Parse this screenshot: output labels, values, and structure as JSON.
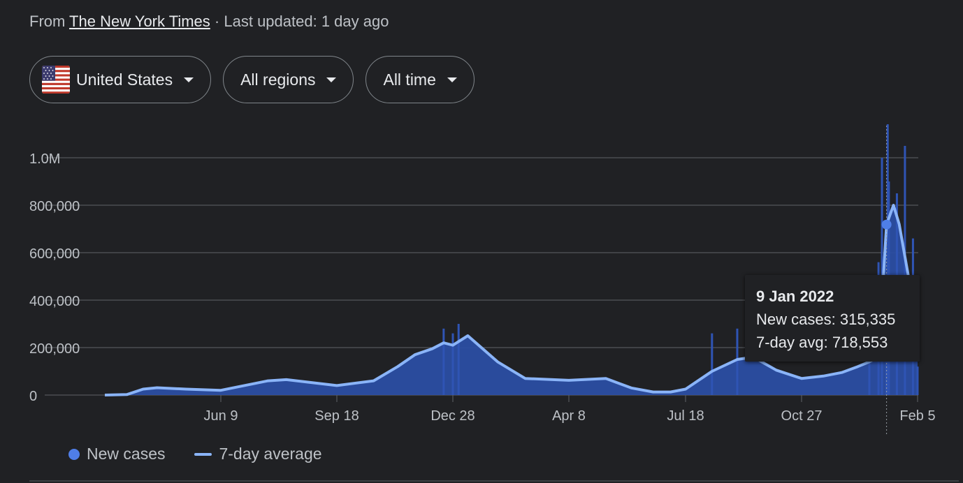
{
  "source": {
    "prefix": "From",
    "publisher": "The New York Times",
    "separator": "·",
    "updated": "Last updated: 1 day ago"
  },
  "filters": [
    {
      "label": "United States",
      "icon": "us-flag-icon"
    },
    {
      "label": "All regions",
      "icon": "caret-down-icon"
    },
    {
      "label": "All time",
      "icon": "caret-down-icon"
    }
  ],
  "colors": {
    "area": "#2b4ea3",
    "bars": "#2f54b4",
    "avg_line": "#8ab4f8",
    "grid": "#5f6368",
    "axis_text": "#bdc1c6",
    "highlight_dot": "#4f7ee8"
  },
  "legend": {
    "new_cases": "New cases",
    "avg": "7-day average"
  },
  "tooltip": {
    "date": "9 Jan 2022",
    "new_cases_label": "New cases:",
    "new_cases_value": "315,335",
    "avg_label": "7-day avg:",
    "avg_value": "718,553"
  },
  "chart_data": {
    "type": "area",
    "y_ticks": [
      {
        "value": 0,
        "label": "0"
      },
      {
        "value": 200000,
        "label": "200,000"
      },
      {
        "value": 400000,
        "label": "400,000"
      },
      {
        "value": 600000,
        "label": "600,000"
      },
      {
        "value": 800000,
        "label": "800,000"
      },
      {
        "value": 1000000,
        "label": "1.0M"
      }
    ],
    "ylim": [
      0,
      1000000
    ],
    "x_ticks": [
      "Jun 9",
      "Sep 18",
      "Dec 28",
      "Apr 8",
      "Jul 18",
      "Oct 27",
      "Feb 5"
    ],
    "grid": true,
    "legend_position": "bottom-left",
    "series": [
      {
        "name": "7-day average",
        "x": [
          "Mar 1 2020",
          "Mar 20 2020",
          "Apr 3 2020",
          "Apr 15 2020",
          "May 10 2020",
          "Jun 9 2020",
          "Jul 20 2020",
          "Aug 5 2020",
          "Sep 18 2020",
          "Oct 20 2020",
          "Nov 10 2020",
          "Nov 25 2020",
          "Dec 10 2020",
          "Dec 20 2020",
          "Dec 28 2020",
          "Jan 10 2021",
          "Feb 5 2021",
          "Mar 1 2021",
          "Apr 8 2021",
          "May 10 2021",
          "Jun 1 2021",
          "Jun 20 2021",
          "Jul 5 2021",
          "Jul 18 2021",
          "Aug 10 2021",
          "Sep 1 2021",
          "Sep 15 2021",
          "Oct 5 2021",
          "Oct 27 2021",
          "Nov 15 2021",
          "Dec 1 2021",
          "Dec 15 2021",
          "Dec 25 2021",
          "Jan 2 2022",
          "Jan 9 2022",
          "Jan 15 2022",
          "Jan 20 2022",
          "Jan 28 2022",
          "Feb 5 2022"
        ],
        "values": [
          0,
          2000,
          25000,
          31000,
          25000,
          20000,
          60000,
          65000,
          40000,
          60000,
          120000,
          170000,
          195000,
          220000,
          210000,
          250000,
          140000,
          70000,
          62000,
          70000,
          30000,
          13000,
          13000,
          25000,
          100000,
          150000,
          160000,
          105000,
          70000,
          80000,
          95000,
          120000,
          140000,
          160000,
          718553,
          800000,
          720000,
          500000,
          380000
        ]
      },
      {
        "name": "New cases",
        "x": [
          "Dec 20 2020",
          "Dec 28 2020",
          "Jan 2 2021",
          "Aug 10 2021",
          "Sep 1 2021",
          "Dec 25 2021",
          "Jan 2 2022",
          "Jan 5 2022",
          "Jan 9 2022",
          "Jan 10 2022",
          "Jan 11 2022",
          "Jan 18 2022",
          "Jan 25 2022",
          "Feb 1 2022",
          "Feb 5 2022"
        ],
        "values": [
          280000,
          260000,
          300000,
          260000,
          280000,
          430000,
          560000,
          1000000,
          315335,
          1150000,
          900000,
          850000,
          1050000,
          660000,
          120000
        ]
      }
    ],
    "highlight": {
      "x": "Jan 9 2022",
      "value": 718553
    }
  }
}
